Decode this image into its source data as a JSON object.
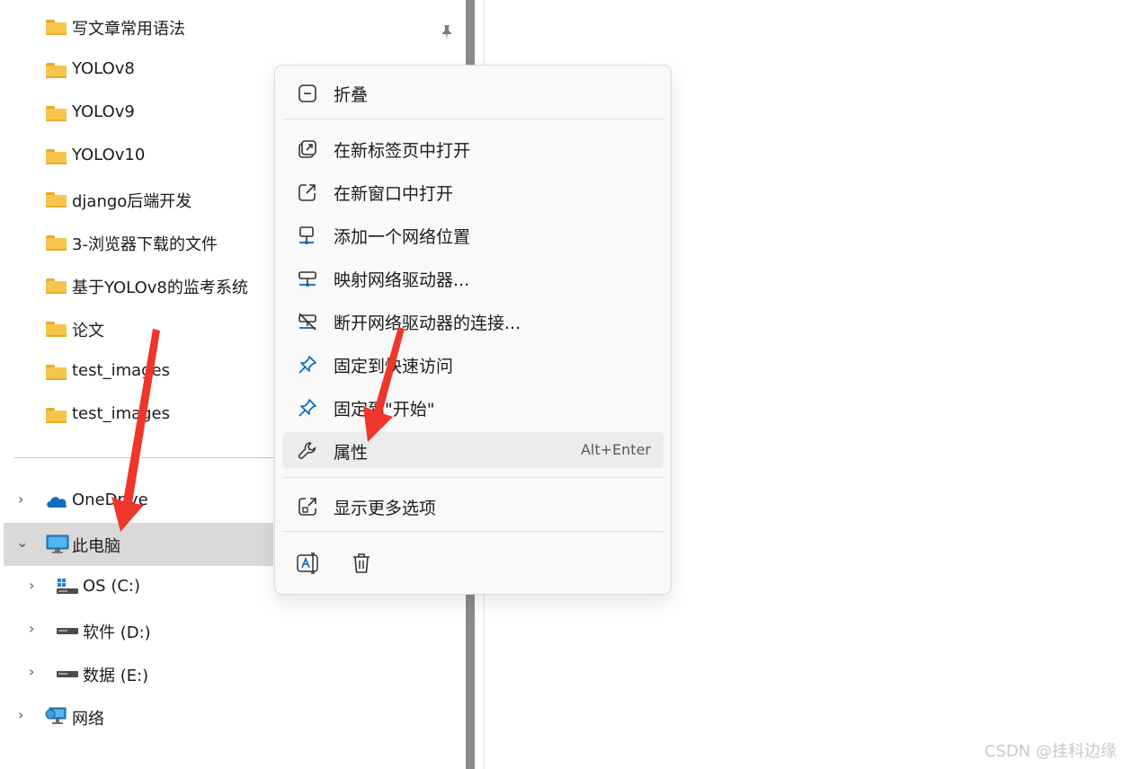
{
  "nav": {
    "folders": [
      "写文章常用语法",
      "YOLOv8",
      "YOLOv9",
      "YOLOv10",
      "django后端开发",
      "3-浏览器下载的文件",
      "基于YOLOv8的监考系统",
      "论文",
      "test_images",
      "test_images"
    ],
    "onedrive": "OneDrive",
    "this_pc": "此电脑",
    "drives": [
      "OS (C:)",
      "软件 (D:)",
      "数据 (E:)"
    ],
    "network": "网络"
  },
  "menu": {
    "collapse": "折叠",
    "open_new_tab": "在新标签页中打开",
    "open_new_window": "在新窗口中打开",
    "add_network_location": "添加一个网络位置",
    "map_network_drive": "映射网络驱动器...",
    "disconnect_network_drive": "断开网络驱动器的连接...",
    "pin_quick_access": "固定到快速访问",
    "pin_start": "固定到\"开始\"",
    "properties": "属性",
    "properties_shortcut": "Alt+Enter",
    "show_more": "显示更多选项"
  },
  "watermark": "CSDN @挂科边缘",
  "colors": {
    "folder": "#f7c549",
    "accent": "#0067c0",
    "annotation_arrow": "#f0352a",
    "selection": "#d9d9d9"
  }
}
